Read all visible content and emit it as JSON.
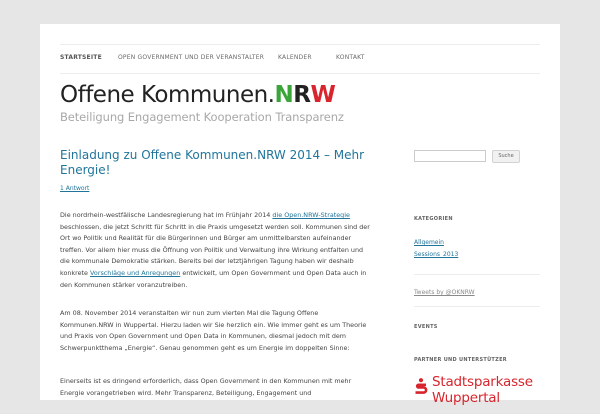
{
  "nav": {
    "items": [
      {
        "label": "STARTSEITE",
        "active": true
      },
      {
        "label": "OPEN GOVERNMENT UND DER VERANSTALTER",
        "active": false
      },
      {
        "label": "KALENDER",
        "active": false
      },
      {
        "label": "KONTAKT",
        "active": false
      }
    ]
  },
  "header": {
    "title_main": "Offene Kommunen.",
    "title_n": "N",
    "title_r": "R",
    "title_w": "W",
    "subtitle": "Beteiligung Engagement Kooperation Transparenz"
  },
  "post": {
    "title": "Einladung zu Offene Kommunen.NRW 2014 – Mehr Energie!",
    "comments_link": "1 Antwort",
    "p1_a": "Die nordrhein-westfälische Landesregierung hat im Frühjahr 2014 ",
    "p1_link1": "die Open.NRW-Strategie",
    "p1_b": " beschlossen, die jetzt Schritt für Schritt in die Praxis umgesetzt werden soll. Kommunen sind der Ort wo Politik und Realität für die Bürgerinnen und Bürger am unmittelbarsten aufeinander treffen. Vor allem hier muss die Öffnung von Politik und Verwaltung ihre Wirkung entfalten und die kommunale Demokratie stärken. Bereits bei der letztjährigen Tagung haben wir deshalb konkrete ",
    "p1_link2": "Vorschläge und Anregungen",
    "p1_c": " entwickelt, um Open Government und Open Data auch in den Kommunen stärker voranzutreiben.",
    "p2": "Am 08. November 2014 veranstalten wir nun zum vierten Mal die Tagung Offene Kommunen.NRW in Wuppertal. Hierzu laden wir Sie herzlich ein. Wie immer geht es um Theorie und Praxis von Open Government und Open Data in Kommunen, diesmal jedoch mit dem Schwerpunktthema „Energie“. Genau genommen geht es um Energie im doppelten Sinne:",
    "p3": "Einerseits ist es dringend erforderlich, dass Open Government in den Kommunen mit mehr Energie vorangetrieben wird. Mehr Transparenz, Beteiligung, Engagement und"
  },
  "sidebar": {
    "search_button": "Suche",
    "search_value": "",
    "categories_title": "KATEGORIEN",
    "categories": [
      "Allgemein",
      "Sessions_2013"
    ],
    "tweets_link": "Tweets by @OKNRW",
    "events_title": "EVENTS",
    "partners_title": "PARTNER UND UNTERSTÜTZER",
    "sponsor_line1": "Stadtsparkasse",
    "sponsor_line2": "Wuppertal"
  },
  "colors": {
    "link": "#21759b",
    "nrw_n": "#3aa63a",
    "nrw_w": "#d8252d",
    "sparkasse_red": "#d8252d"
  }
}
